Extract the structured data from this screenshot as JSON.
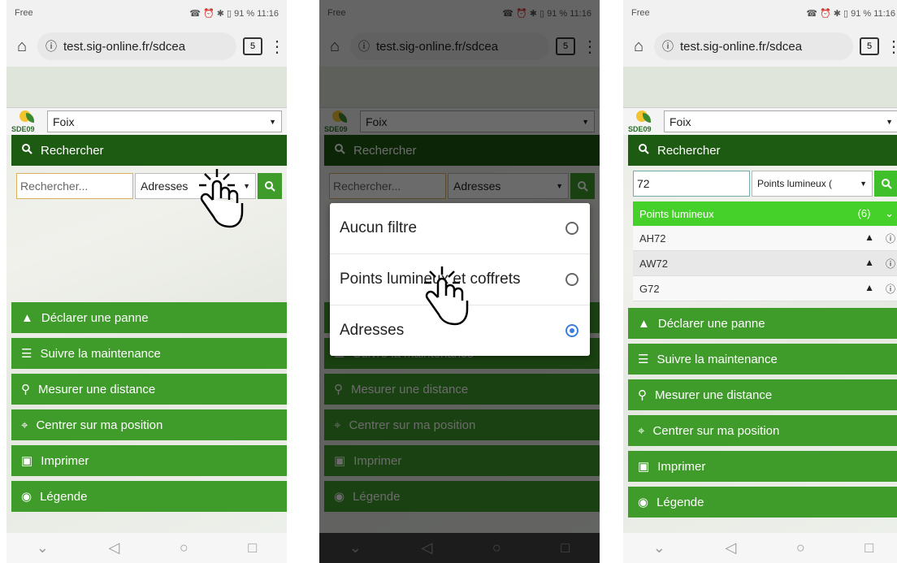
{
  "status": {
    "carrier": "Free",
    "battery": "91 %",
    "time": "11:16",
    "indicators": "☎ ⏰ ✱ ▯"
  },
  "browser": {
    "url": "test.sig-online.fr/sdcea",
    "tab_count": "5"
  },
  "header": {
    "logo_text": "SDE09",
    "commune": "Foix"
  },
  "search": {
    "title": "Rechercher",
    "placeholder": "Rechercher...",
    "filter_addresses": "Adresses",
    "query": "72",
    "filter_points": "Points lumineux ("
  },
  "menu_items": [
    {
      "icon": "warning-icon",
      "label": "Déclarer une panne"
    },
    {
      "icon": "list-icon",
      "label": "Suivre la maintenance"
    },
    {
      "icon": "pin-icon",
      "label": "Mesurer une distance"
    },
    {
      "icon": "location-icon",
      "label": "Centrer sur ma position"
    },
    {
      "icon": "document-icon",
      "label": "Imprimer"
    },
    {
      "icon": "globe-icon",
      "label": "Légende"
    }
  ],
  "dialog_options": [
    {
      "label": "Aucun filtre",
      "selected": false
    },
    {
      "label": "Points lumineux et coffrets",
      "selected": false
    },
    {
      "label": "Adresses",
      "selected": true
    }
  ],
  "results": {
    "group_label": "Points lumineux",
    "count": "(6)",
    "items": [
      "AH72",
      "AW72",
      "G72"
    ]
  },
  "colors": {
    "dark_green": "#1d5a12",
    "green": "#3f9b2a",
    "bright_green": "#46d12a",
    "radio_blue": "#3b7ddd"
  }
}
